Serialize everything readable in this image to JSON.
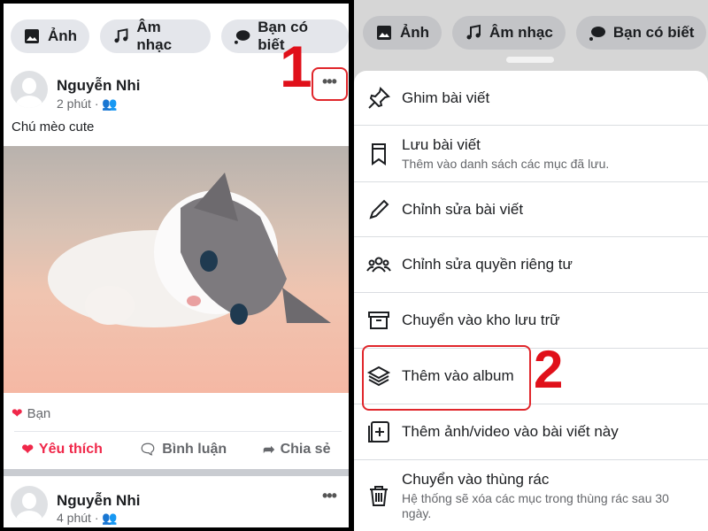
{
  "chips": [
    {
      "label": "Ảnh",
      "icon": "photo-icon"
    },
    {
      "label": "Âm nhạc",
      "icon": "music-icon"
    },
    {
      "label": "Bạn có biết",
      "icon": "speech-bubble-icon"
    }
  ],
  "post1": {
    "author": "Nguyễn Nhi",
    "time": "2 phút ·",
    "caption": "Chú mèo cute",
    "reaction": "Bạn",
    "actions": {
      "like": "Yêu thích",
      "comment": "Bình luận",
      "share": "Chia sẻ"
    }
  },
  "post2": {
    "author": "Nguyễn Nhi",
    "time": "4 phút ·"
  },
  "annotations": {
    "step1": "1",
    "step2": "2",
    "color": "#e0101a"
  },
  "menu": [
    {
      "title": "Ghim bài viết",
      "icon": "pin-icon"
    },
    {
      "title": "Lưu bài viết",
      "subtitle": "Thêm vào danh sách các mục đã lưu.",
      "icon": "bookmark-icon"
    },
    {
      "title": "Chỉnh sửa bài viết",
      "icon": "pencil-icon"
    },
    {
      "title": "Chỉnh sửa quyền riêng tư",
      "icon": "people-icon"
    },
    {
      "title": "Chuyển vào kho lưu trữ",
      "icon": "archive-icon"
    },
    {
      "title": "Thêm vào album",
      "icon": "layers-icon"
    },
    {
      "title": "Thêm ảnh/video vào bài viết này",
      "icon": "add-media-icon"
    },
    {
      "title": "Chuyển vào thùng rác",
      "subtitle": "Hệ thống sẽ xóa các mục trong thùng rác sau 30 ngày.",
      "icon": "trash-icon"
    }
  ]
}
